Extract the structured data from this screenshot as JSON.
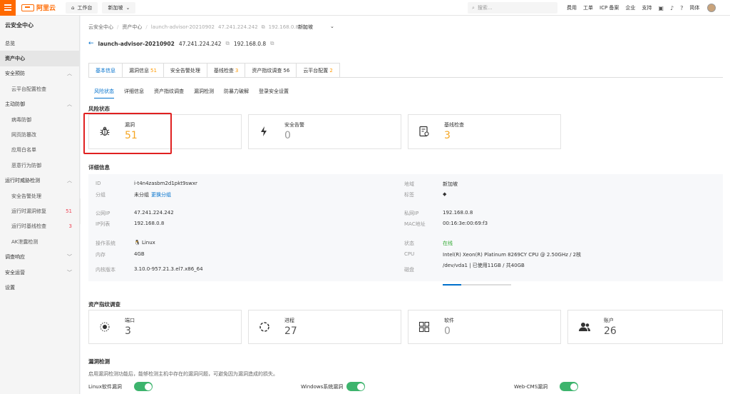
{
  "topbar": {
    "logo": "阿里云",
    "workbench": "工作台",
    "region": "新加坡",
    "search_placeholder": "搜索...",
    "links": [
      "费用",
      "工单",
      "ICP 备案",
      "企业",
      "支持"
    ],
    "lang": "简体"
  },
  "sidebar": {
    "title": "云安全中心",
    "items": [
      {
        "label": "总览"
      },
      {
        "label": "资产中心"
      },
      {
        "label": "安全预防"
      },
      {
        "label": "云平台配置检查"
      },
      {
        "label": "主动防御"
      },
      {
        "label": "病毒防御"
      },
      {
        "label": "网页防篡改"
      },
      {
        "label": "应用白名单"
      },
      {
        "label": "恶意行为防御"
      },
      {
        "label": "运行时威胁检测"
      },
      {
        "label": "安全告警处理"
      },
      {
        "label": "运行时漏洞修复",
        "count": "51"
      },
      {
        "label": "运行时基线检查",
        "count": "3"
      },
      {
        "label": "AK泄露检测"
      },
      {
        "label": "调查响应"
      },
      {
        "label": "安全运营"
      },
      {
        "label": "设置"
      }
    ]
  },
  "breadcrumb": {
    "items": [
      "云安全中心",
      "资产中心",
      "launch-advisor-20210902",
      "47.241.224.242",
      "192.168.0.8"
    ],
    "region": "新加坡"
  },
  "header": {
    "name": "launch-advisor-20210902",
    "public_ip": "47.241.224.242",
    "private_ip": "192.168.0.8"
  },
  "tabs": [
    {
      "label": "基本信息",
      "num": ""
    },
    {
      "label": "漏洞信息",
      "num": "51"
    },
    {
      "label": "安全告警处理",
      "num": ""
    },
    {
      "label": "基线检查",
      "num": "3"
    },
    {
      "label": "资产指纹调查",
      "num": "56"
    },
    {
      "label": "云平台配置",
      "num": "2"
    }
  ],
  "subtabs": [
    "风险状态",
    "详细信息",
    "资产指纹调查",
    "漏洞检测",
    "防暴力破解",
    "登录安全设置"
  ],
  "risk": {
    "title": "风险状态",
    "cards": [
      {
        "label": "漏洞",
        "value": "51",
        "icon": "bug-icon"
      },
      {
        "label": "安全告警",
        "value": "0",
        "icon": "lightning-icon"
      },
      {
        "label": "基线检查",
        "value": "3",
        "icon": "checklist-icon"
      }
    ]
  },
  "details": {
    "title": "详细信息",
    "id_k": "ID",
    "id_v": "i-t4n4zasbm2d1pkt9swxr",
    "group_k": "分组",
    "group_v": "未分组",
    "group_link": "更换分组",
    "region_k": "地域",
    "region_v": "新加坡",
    "tag_k": "标签",
    "public_ip_k": "公网IP",
    "public_ip_v": "47.241.224.242",
    "ip_list_k": "IP列表",
    "ip_list_v": "192.168.0.8",
    "private_ip_k": "私网IP",
    "private_ip_v": "192.168.0.8",
    "mac_k": "MAC地址",
    "mac_v": "00:16:3e:00:69:f3",
    "os_k": "操作系统",
    "os_v": "Linux",
    "mem_k": "内存",
    "mem_v": "4GB",
    "kernel_k": "内核版本",
    "kernel_v": "3.10.0-957.21.3.el7.x86_64",
    "status_k": "状态",
    "status_v": "在线",
    "cpu_k": "CPU",
    "cpu_v": "Intel(R) Xeon(R) Platinum 8269CY CPU @ 2.50GHz / 2核",
    "disk_k": "磁盘",
    "disk_v": "/dev/vda1 | 已使用11GB / 共40GB",
    "disk_used_fraction": 0.275
  },
  "fingerprint": {
    "title": "资产指纹调查",
    "cards": [
      {
        "label": "端口",
        "value": "3",
        "icon": "port-icon"
      },
      {
        "label": "进程",
        "value": "27",
        "icon": "process-icon"
      },
      {
        "label": "软件",
        "value": "0",
        "icon": "software-icon"
      },
      {
        "label": "账户",
        "value": "26",
        "icon": "account-icon"
      }
    ]
  },
  "vuln": {
    "title": "漏洞检测",
    "desc": "启用漏洞检测功能后，能够检测主机中存在的漏洞问题，可避免因为漏洞造成的损失。",
    "toggles": [
      {
        "label": "Linux软件漏洞",
        "on": true
      },
      {
        "label": "Windows系统漏洞",
        "on": true
      },
      {
        "label": "Web-CMS漏洞",
        "on": true
      }
    ]
  }
}
